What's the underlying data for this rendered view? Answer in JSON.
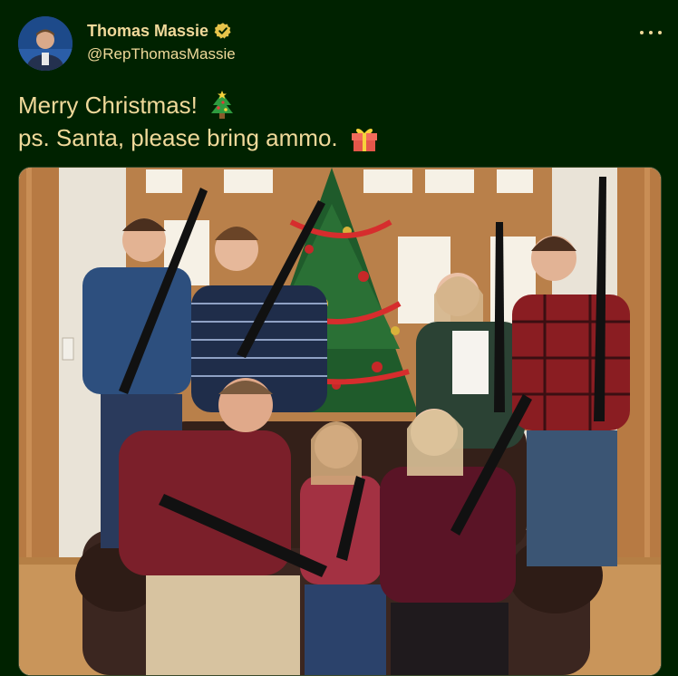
{
  "tweet": {
    "author_name": "Thomas Massie",
    "author_handle": "@RepThomasMassie",
    "text_line1": "Merry Christmas!",
    "text_line2": "ps. Santa, please bring ammo.",
    "icons": {
      "verified": "verified-badge-icon",
      "more": "more-options-icon",
      "tree": "christmas-tree-emoji",
      "gift": "gift-emoji"
    },
    "colors": {
      "background": "#002200",
      "text": "#f0d99a",
      "verified": "#e6c34a"
    }
  }
}
